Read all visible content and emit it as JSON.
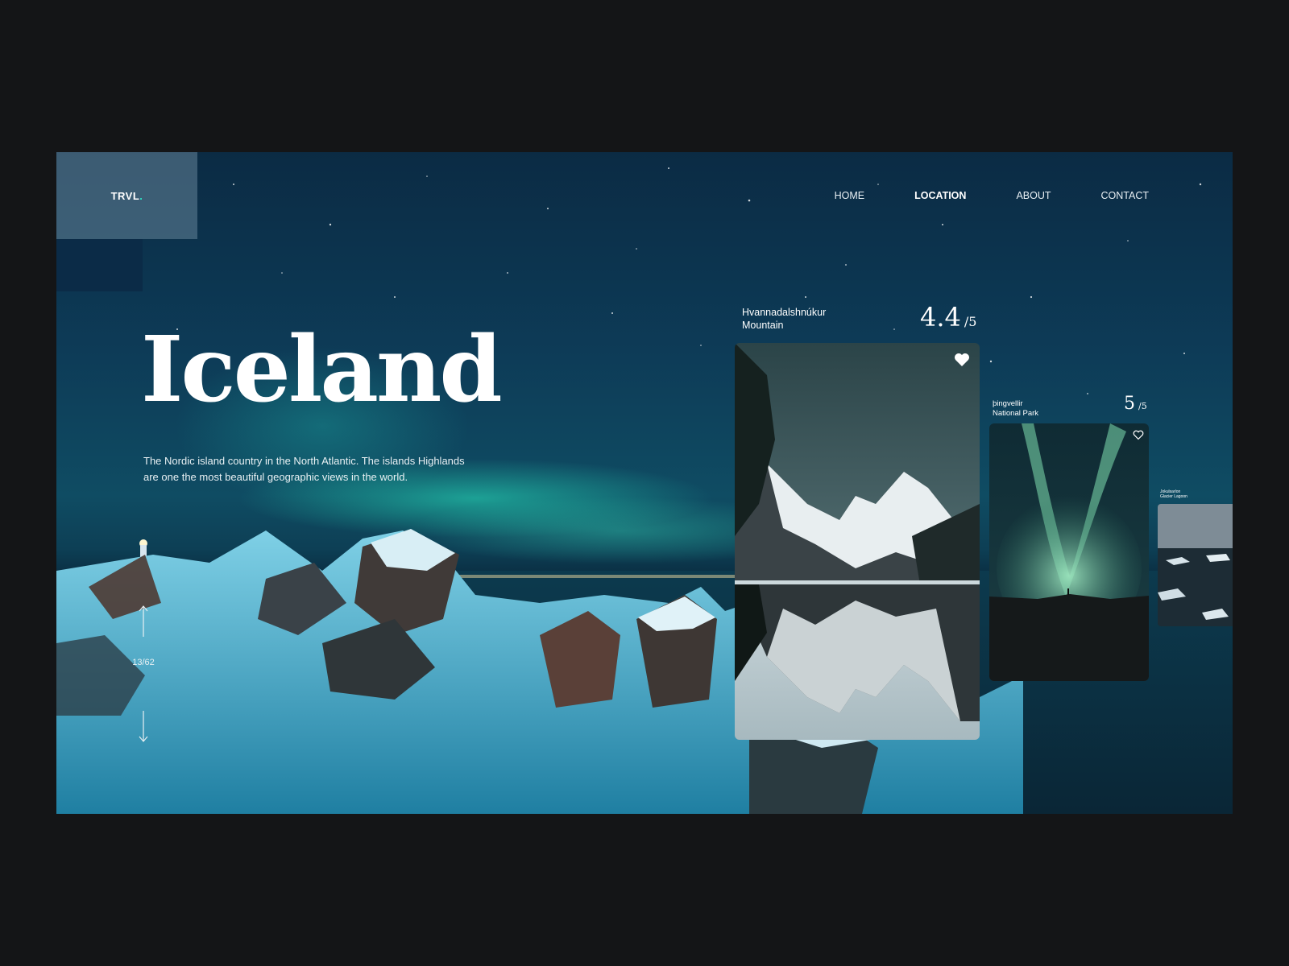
{
  "brand": {
    "logo": "TRVL",
    "logo_dot": "."
  },
  "nav": {
    "items": [
      {
        "label": "HOME",
        "active": false
      },
      {
        "label": "LOCATION",
        "active": true
      },
      {
        "label": "ABOUT",
        "active": false
      },
      {
        "label": "CONTACT",
        "active": false
      }
    ]
  },
  "hero": {
    "title": "Iceland",
    "description": "The Nordic island country in the North Atlantic. The islands Highlands are one the most beautiful geographic views in the world."
  },
  "pager": {
    "current": "13/62",
    "up_icon": "arrow-up-icon",
    "down_icon": "arrow-down-icon"
  },
  "cards": [
    {
      "title_line1": "Hvannadalshnúkur",
      "title_line2": "Mountain",
      "rating": "4.4",
      "rating_max": "/5",
      "icon": "heart-icon"
    },
    {
      "title_line1": "þingvellir",
      "title_line2": "National Park",
      "rating": "5",
      "rating_max": "/5",
      "icon": "heart-icon"
    },
    {
      "title_line1": "Jokulsarlon",
      "title_line2": "Glacier Lagoon"
    }
  ],
  "colors": {
    "accent": "#2fe3c6",
    "background": "#141517",
    "frame_sky": "#0d3b57"
  }
}
